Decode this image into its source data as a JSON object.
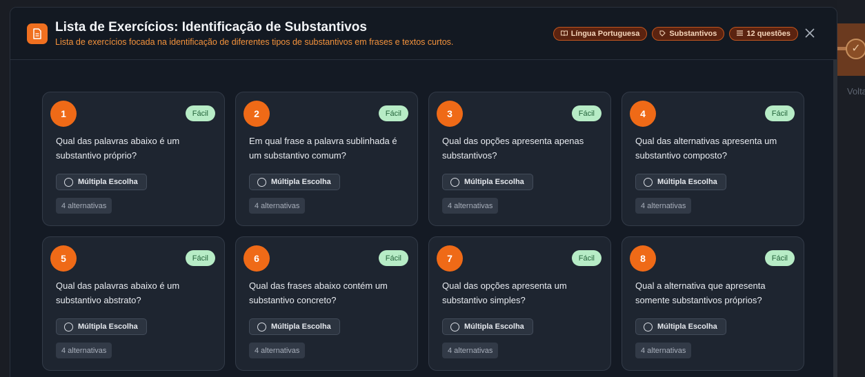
{
  "modal": {
    "title": "Lista de Exercícios: Identificação de Substantivos",
    "subtitle": "Lista de exercícios focada na identificação de diferentes tipos de substantivos em frases e textos curtos.",
    "badges": [
      {
        "icon": "book-icon",
        "glyph": "📖",
        "label": "Língua Portuguesa"
      },
      {
        "icon": "tag-icon",
        "glyph": "⁀",
        "label": "Substantivos"
      },
      {
        "icon": "list-icon",
        "glyph": "≡",
        "label": "12 questões"
      }
    ],
    "close_label": "×"
  },
  "cards": [
    {
      "number": "1",
      "difficulty": "Fácil",
      "question": "Qual das palavras abaixo é um substantivo próprio?",
      "type": "Múltipla Escolha",
      "alternatives": "4 alternativas"
    },
    {
      "number": "2",
      "difficulty": "Fácil",
      "question": "Em qual frase a palavra sublinhada é um substantivo comum?",
      "type": "Múltipla Escolha",
      "alternatives": "4 alternativas"
    },
    {
      "number": "3",
      "difficulty": "Fácil",
      "question": "Qual das opções apresenta apenas substantivos?",
      "type": "Múltipla Escolha",
      "alternatives": "4 alternativas"
    },
    {
      "number": "4",
      "difficulty": "Fácil",
      "question": "Qual das alternativas apresenta um substantivo composto?",
      "type": "Múltipla Escolha",
      "alternatives": "4 alternativas"
    },
    {
      "number": "5",
      "difficulty": "Fácil",
      "question": "Qual das palavras abaixo é um substantivo abstrato?",
      "type": "Múltipla Escolha",
      "alternatives": "4 alternativas"
    },
    {
      "number": "6",
      "difficulty": "Fácil",
      "question": "Qual das frases abaixo contém um substantivo concreto?",
      "type": "Múltipla Escolha",
      "alternatives": "4 alternativas"
    },
    {
      "number": "7",
      "difficulty": "Fácil",
      "question": "Qual das opções apresenta um substantivo simples?",
      "type": "Múltipla Escolha",
      "alternatives": "4 alternativas"
    },
    {
      "number": "8",
      "difficulty": "Fácil",
      "question": "Qual a alternativa que apresenta somente substantivos próprios?",
      "type": "Múltipla Escolha",
      "alternatives": "4 alternativas"
    }
  ],
  "background": {
    "link_text": "Volta"
  },
  "colors": {
    "accent": "#ef6a17",
    "easy_badge_bg": "#b7ecc6",
    "easy_badge_text": "#23633a"
  }
}
